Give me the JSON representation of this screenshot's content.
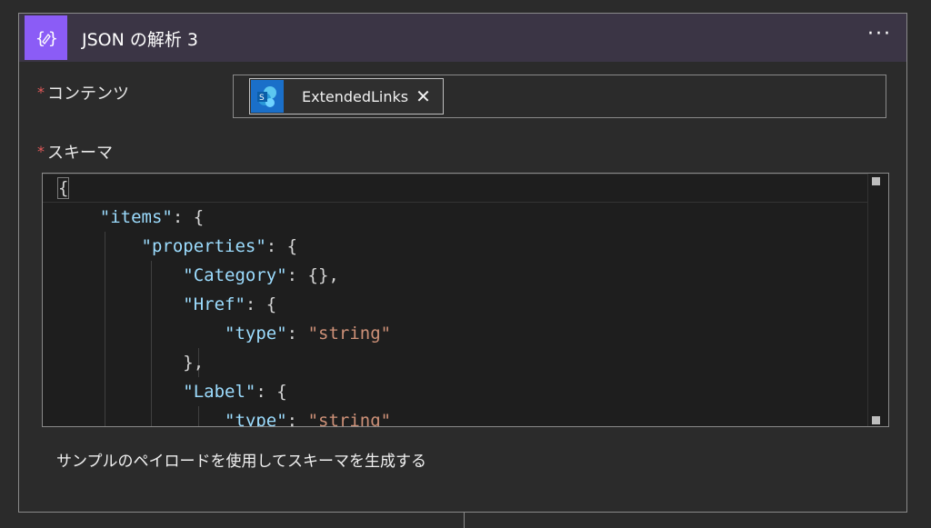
{
  "header": {
    "title": "JSON の解析 3",
    "icon": "edit-braces-icon",
    "menu": "···",
    "accent_color": "#8b5cf6"
  },
  "fields": {
    "content": {
      "required_mark": "*",
      "label": "コンテンツ",
      "token": {
        "label": "ExtendedLinks",
        "close": "✕",
        "icon": "sharepoint-icon"
      }
    },
    "schema": {
      "required_mark": "*",
      "label": "スキーマ"
    }
  },
  "editor": {
    "lines": [
      [
        "{"
      ],
      [
        "\"items\"",
        ": {"
      ],
      [
        "\"properties\"",
        ": {"
      ],
      [
        "\"Category\"",
        ": {},"
      ],
      [
        "\"Href\"",
        ": {"
      ],
      [
        "\"type\"",
        ": ",
        "\"string\""
      ],
      [
        "},"
      ],
      [
        "\"Label\"",
        ": {"
      ],
      [
        "\"type\"",
        ": ",
        "\"string\""
      ]
    ]
  },
  "generate_link": "サンプルのペイロードを使用してスキーマを生成する"
}
